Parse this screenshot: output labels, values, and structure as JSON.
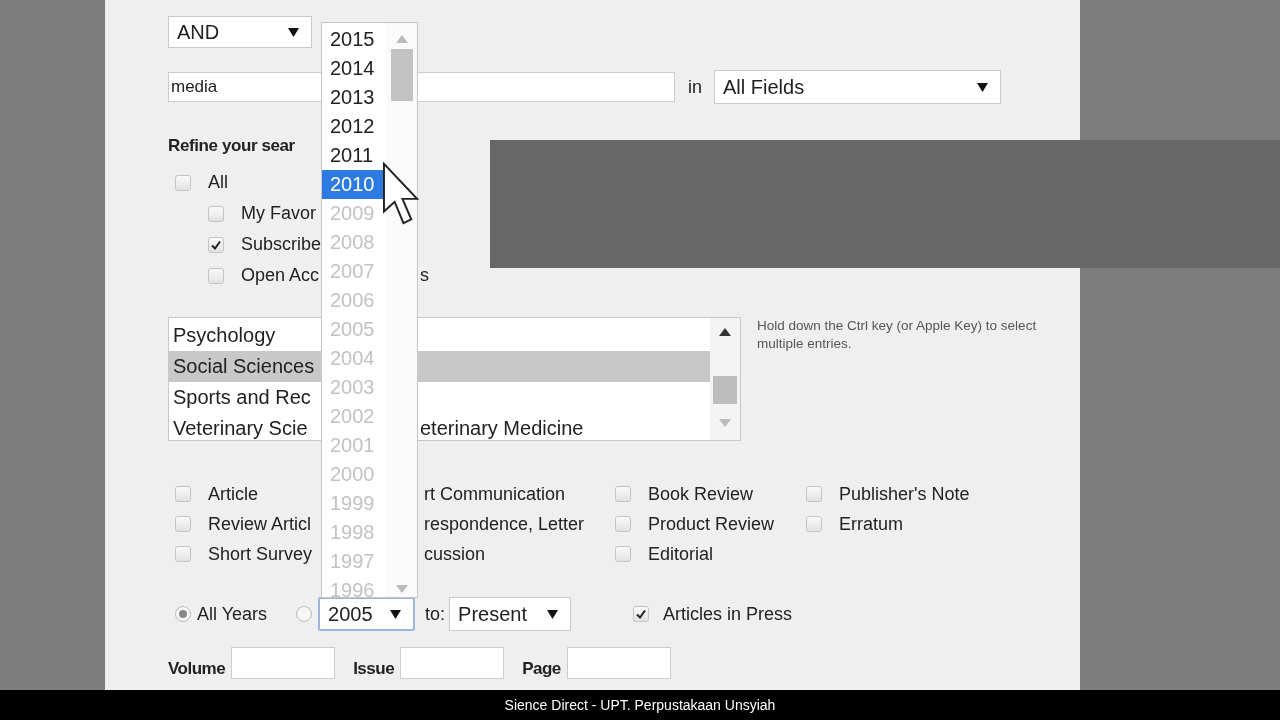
{
  "connector_select": {
    "value": "AND"
  },
  "search": {
    "value": "media",
    "in_label": "in",
    "field_select": {
      "value": "All Fields"
    }
  },
  "refine": {
    "heading": "Refine your sear",
    "options": [
      {
        "label": "All",
        "checked": false,
        "children": [
          {
            "label": "My Favor",
            "checked": false
          },
          {
            "label": "Subscribe",
            "checked": true
          },
          {
            "label": "Open Acc",
            "label_end": "s",
            "checked": false
          }
        ]
      }
    ]
  },
  "subjects": {
    "items": [
      {
        "text": "Psychology",
        "selected": false
      },
      {
        "text": "Social Sciences",
        "selected": true
      },
      {
        "text": "Sports and Rec",
        "selected": false
      },
      {
        "text": "Veterinary Scie",
        "text_after": "eterinary Medicine",
        "selected": false
      }
    ],
    "hint": "Hold down the Ctrl key (or Apple Key) to select multiple entries."
  },
  "document_types": [
    [
      {
        "kind": "checkbox",
        "label": "Article",
        "checked": false
      },
      {
        "kind": "text",
        "label": "rt Communication"
      },
      {
        "kind": "checkbox",
        "label": "Book Review",
        "checked": false
      },
      {
        "kind": "checkbox",
        "label": "Publisher's Note",
        "checked": false
      }
    ],
    [
      {
        "kind": "checkbox",
        "label": "Review Articl",
        "checked": false
      },
      {
        "kind": "text",
        "label": "respondence, Letter"
      },
      {
        "kind": "checkbox",
        "label": "Product Review",
        "checked": false
      },
      {
        "kind": "checkbox",
        "label": "Erratum",
        "checked": false
      }
    ],
    [
      {
        "kind": "checkbox",
        "label": "Short Survey",
        "checked": false
      },
      {
        "kind": "text",
        "label": "cussion"
      },
      {
        "kind": "checkbox",
        "label": "Editorial",
        "checked": false
      }
    ]
  ],
  "years": {
    "all_years": {
      "label": "All Years",
      "selected": true
    },
    "range": {
      "selected": false,
      "from": "2005",
      "to_label": "to:",
      "to": "Present"
    },
    "in_press": {
      "label": "Articles in Press",
      "checked": true
    }
  },
  "citation": [
    {
      "label": "Volume"
    },
    {
      "label": "Issue"
    },
    {
      "label": "Page"
    }
  ],
  "year_dropdown": {
    "items": [
      {
        "text": "2015",
        "selected": false,
        "disabled": false
      },
      {
        "text": "2014",
        "selected": false,
        "disabled": false
      },
      {
        "text": "2013",
        "selected": false,
        "disabled": false
      },
      {
        "text": "2012",
        "selected": false,
        "disabled": false
      },
      {
        "text": "2011",
        "selected": false,
        "disabled": false
      },
      {
        "text": "2010",
        "selected": true,
        "disabled": false
      },
      {
        "text": "2009",
        "selected": false,
        "disabled": true
      },
      {
        "text": "2008",
        "selected": false,
        "disabled": true
      },
      {
        "text": "2007",
        "selected": false,
        "disabled": true
      },
      {
        "text": "2006",
        "selected": false,
        "disabled": true
      },
      {
        "text": "2005",
        "selected": false,
        "disabled": true
      },
      {
        "text": "2004",
        "selected": false,
        "disabled": true
      },
      {
        "text": "2003",
        "selected": false,
        "disabled": true
      },
      {
        "text": "2002",
        "selected": false,
        "disabled": true
      },
      {
        "text": "2001",
        "selected": false,
        "disabled": true
      },
      {
        "text": "2000",
        "selected": false,
        "disabled": true
      },
      {
        "text": "1999",
        "selected": false,
        "disabled": true
      },
      {
        "text": "1998",
        "selected": false,
        "disabled": true
      },
      {
        "text": "1997",
        "selected": false,
        "disabled": true
      },
      {
        "text": "1996",
        "selected": false,
        "disabled": true
      }
    ]
  },
  "caption": "Sience Direct - UPT. Perpustakaan Unsyiah"
}
